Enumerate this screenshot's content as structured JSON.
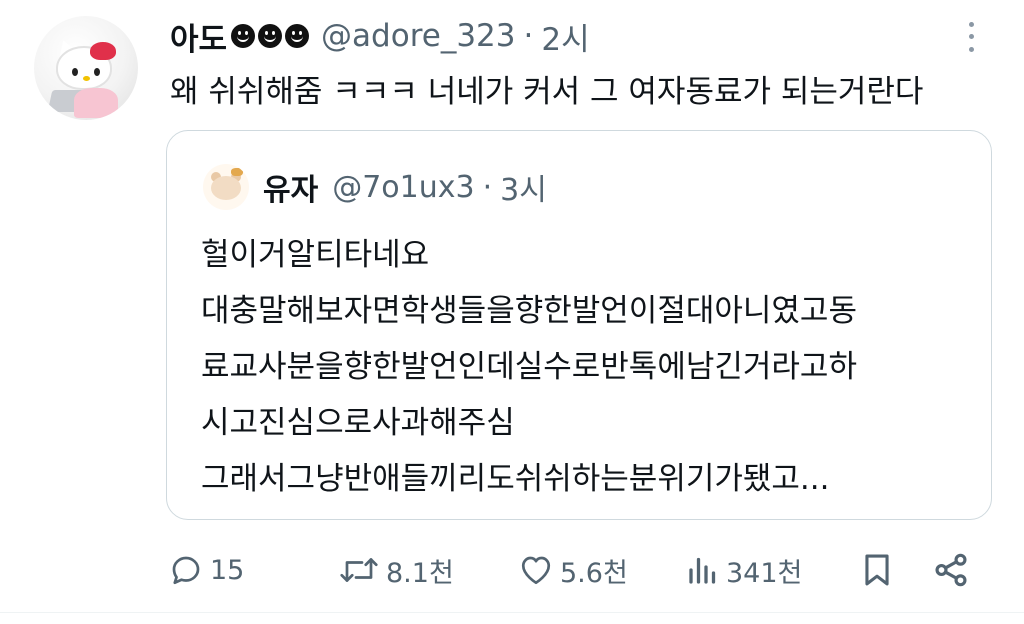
{
  "tweet": {
    "display_name": "아도",
    "emoji_icons": [
      "smiley-icon",
      "smiley-icon",
      "smiley-icon"
    ],
    "handle": "@adore_323",
    "separator": "·",
    "time": "2시",
    "text": "왜 쉬쉬해줌 ㅋㅋㅋ 너네가 커서 그 여자동료가 되는거란다"
  },
  "quote": {
    "display_name": "유자",
    "handle": "@7o1ux3",
    "separator": "·",
    "time": "3시",
    "lines": [
      "헐이거알티타네요",
      "대충말해보자면학생들을향한발언이절대아니였고동",
      "료교사분을향한발언인데실수로반톡에남긴거라고하",
      "시고진심으로사과해주심",
      "그래서그냥반애들끼리도쉬쉬하는분위기가됐고..."
    ]
  },
  "actions": {
    "replies": "15",
    "retweets": "8.1천",
    "likes": "5.6천",
    "views": "341천"
  },
  "colors": {
    "text_primary": "#0f1419",
    "text_secondary": "#536471",
    "border": "#cfd9de"
  }
}
